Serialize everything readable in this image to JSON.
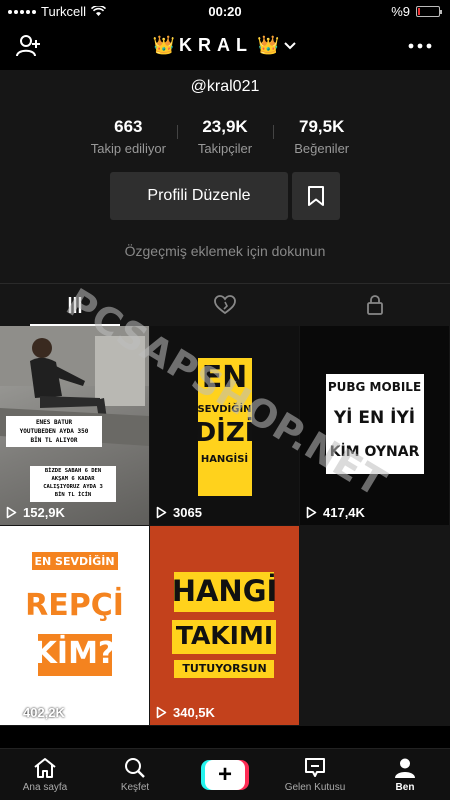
{
  "status_bar": {
    "carrier": "Turkcell",
    "time": "00:20",
    "battery": "%9",
    "battery_level": 0.09
  },
  "header": {
    "account_name": "KRAL",
    "crown_left": "👑",
    "crown_right": "👑",
    "icons": [
      "add-user-icon",
      "chevron-down-icon",
      "more-icon"
    ]
  },
  "profile": {
    "handle": "@kral021",
    "stats": [
      {
        "value": "663",
        "label": "Takip ediliyor"
      },
      {
        "value": "23,9K",
        "label": "Takipçiler"
      },
      {
        "value": "79,5K",
        "label": "Beğeniler"
      }
    ],
    "edit_button": "Profili Düzenle",
    "bio_hint": "Özgeçmiş eklemek için dokunun"
  },
  "tabs": [
    {
      "icon": "grid-icon",
      "active": true
    },
    {
      "icon": "liked-heart-icon",
      "active": false
    },
    {
      "icon": "lock-icon",
      "active": false
    }
  ],
  "videos": [
    {
      "views": "152,9K",
      "caption_top": [
        "ENES BATUR",
        "YOUTUBEDEN AYDA 350",
        "BİN TL ALIYOR"
      ],
      "caption_bottom": [
        "BİZDE SABAH 6 DEN",
        "AKŞAM 6 KADAR",
        "CALIŞIYORUZ AYDA 3",
        "BİN TL İCİN"
      ]
    },
    {
      "views": "3065",
      "lines": [
        "EN",
        "SEVDİĞİN",
        "DİZİ",
        "HANGİSİ"
      ]
    },
    {
      "views": "417,4K",
      "lines": [
        "PUBG MOBILE",
        "Yİ EN İYİ",
        "KİM OYNAR"
      ]
    },
    {
      "views": "402,2K",
      "lines": [
        "EN SEVDİĞİN",
        "REPÇİ",
        "KİM?"
      ]
    },
    {
      "views": "340,5K",
      "lines": [
        "HANGİ",
        "TAKIMI",
        "TUTUYORSUN"
      ]
    }
  ],
  "watermark": "PCSAPSHOP.NET",
  "bottom_nav": [
    {
      "label": "Ana sayfa",
      "icon": "home-icon"
    },
    {
      "label": "Keşfet",
      "icon": "search-icon"
    },
    {
      "label": "",
      "icon": "plus-icon"
    },
    {
      "label": "Gelen Kutusu",
      "icon": "inbox-icon"
    },
    {
      "label": "Ben",
      "icon": "profile-icon"
    }
  ],
  "colors": {
    "accent_pink": "#fe2c55",
    "accent_cyan": "#25f4ee",
    "yellow_text": "#ffd21c",
    "red_orange": "#c3411c"
  }
}
